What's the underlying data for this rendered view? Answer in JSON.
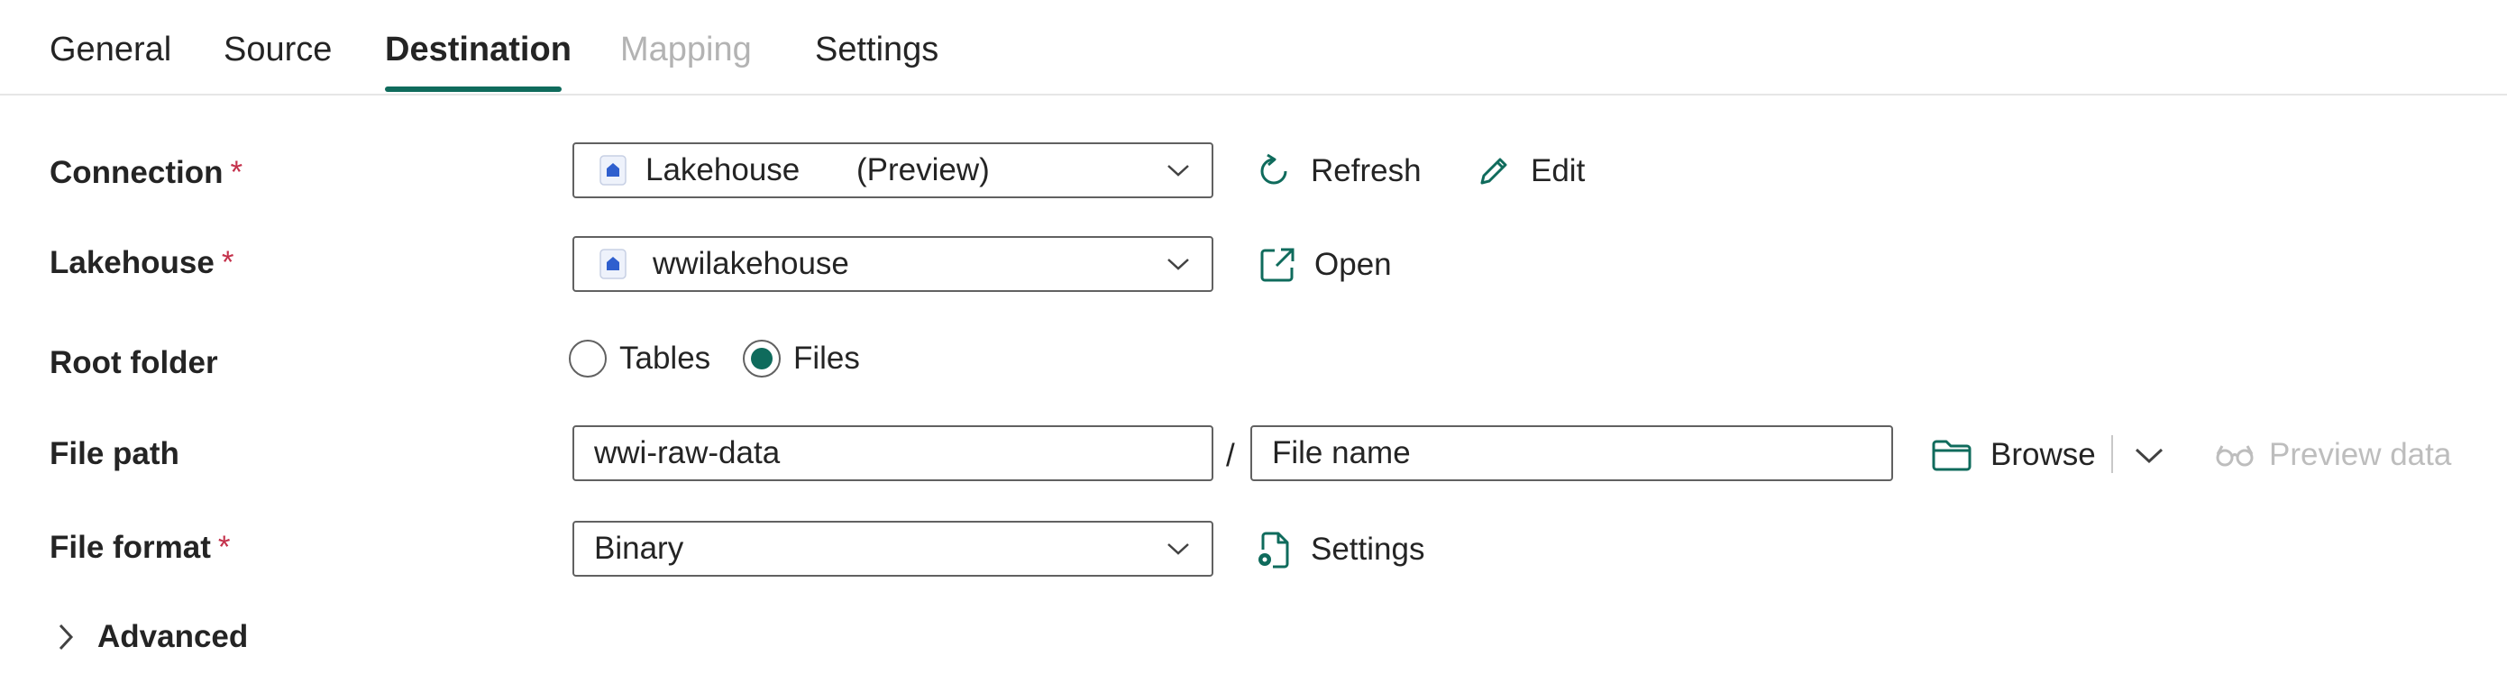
{
  "tabs": [
    {
      "label": "General",
      "state": "normal"
    },
    {
      "label": "Source",
      "state": "normal"
    },
    {
      "label": "Destination",
      "state": "active"
    },
    {
      "label": "Mapping",
      "state": "disabled"
    },
    {
      "label": "Settings",
      "state": "normal"
    }
  ],
  "colors": {
    "accent": "#0f6b5c",
    "required": "#c4314b",
    "disabled": "#bdbdbd"
  },
  "form": {
    "connection": {
      "label": "Connection",
      "required_mark": "*",
      "value": "Lakehouse",
      "value_suffix": "(Preview)",
      "icon": "lakehouse-icon",
      "refresh_label": "Refresh",
      "edit_label": "Edit"
    },
    "lakehouse": {
      "label": "Lakehouse",
      "required_mark": "*",
      "value": "wwilakehouse",
      "icon": "lakehouse-icon",
      "open_label": "Open"
    },
    "root_folder": {
      "label": "Root folder",
      "options": [
        {
          "label": "Tables",
          "selected": false
        },
        {
          "label": "Files",
          "selected": true
        }
      ]
    },
    "file_path": {
      "label": "File path",
      "folder_value": "wwi-raw-data",
      "separator": "/",
      "file_name_placeholder": "File name",
      "browse_label": "Browse",
      "preview_label": "Preview data"
    },
    "file_format": {
      "label": "File format",
      "required_mark": "*",
      "value": "Binary",
      "settings_label": "Settings"
    },
    "advanced": {
      "label": "Advanced"
    }
  }
}
